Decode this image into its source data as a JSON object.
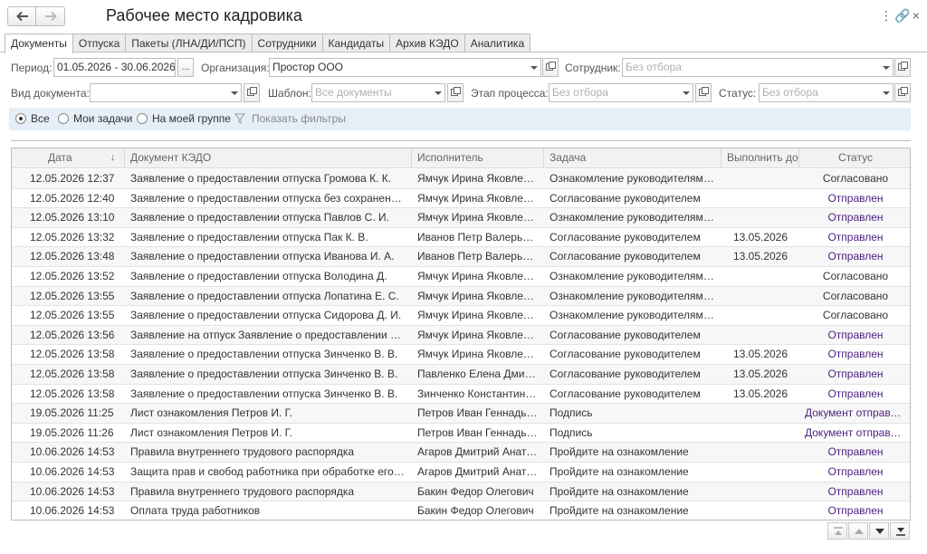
{
  "window": {
    "title": "Рабочее место кадровика"
  },
  "titlebar_icons": [
    "more-icon",
    "link-icon",
    "close-icon"
  ],
  "tabs": [
    {
      "label": "Документы",
      "active": true
    },
    {
      "label": "Отпуска"
    },
    {
      "label": "Пакеты (ЛНА/ДИ/ПСП)"
    },
    {
      "label": "Сотрудники"
    },
    {
      "label": "Кандидаты"
    },
    {
      "label": "Архив КЭДО"
    },
    {
      "label": "Аналитика"
    }
  ],
  "filters": {
    "period_label": "Период:",
    "period_value": "01.05.2026 - 30.06.2026",
    "period_btn": "...",
    "org_label": "Организация:",
    "org_value": "Простор ООО",
    "employee_label": "Сотрудник:",
    "employee_placeholder": "Без отбора",
    "doctype_label": "Вид документа:",
    "doctype_value": "",
    "template_label": "Шаблон:",
    "template_placeholder": "Все документы",
    "stage_label": "Этап процесса:",
    "stage_placeholder": "Без отбора",
    "status_label": "Статус:",
    "status_placeholder": "Без отбора"
  },
  "scope": {
    "all": "Все",
    "my_tasks": "Мои задачи",
    "my_group": "На моей группе",
    "show_filters": "Показать фильтры",
    "selected": "all"
  },
  "table": {
    "columns": {
      "date": "Дата",
      "doc": "Документ КЭДО",
      "executor": "Исполнитель",
      "task": "Задача",
      "due": "Выполнить до",
      "status": "Статус"
    },
    "sort_indicator": "↓",
    "rows": [
      {
        "date": "12.05.2026 12:37",
        "doc": "Заявление о предоставлении отпуска Громова К. К.",
        "executor": "Ямчук Ирина Яковлевна",
        "task": "Ознакомление руководителями ...",
        "due": "",
        "status": "Согласовано"
      },
      {
        "date": "12.05.2026 12:40",
        "doc": "Заявление о предоставлении отпуска без сохранения з...",
        "executor": "Ямчук Ирина Яковлевна",
        "task": "Согласование руководителем",
        "due": "",
        "status": "Отправлен"
      },
      {
        "date": "12.05.2026 13:10",
        "doc": "Заявление о предоставлении отпуска Павлов С. И.",
        "executor": "Ямчук Ирина Яковлевна",
        "task": "Ознакомление руководителями ...",
        "due": "",
        "status": "Отправлен"
      },
      {
        "date": "12.05.2026 13:32",
        "doc": "Заявление о предоставлении отпуска Пак К. В.",
        "executor": "Иванов Петр Валерьян...",
        "task": "Согласование руководителем",
        "due": "13.05.2026",
        "status": "Отправлен"
      },
      {
        "date": "12.05.2026 13:48",
        "doc": "Заявление о предоставлении отпуска Иванова И. А.",
        "executor": "Иванов Петр Валерьян...",
        "task": "Согласование руководителем",
        "due": "13.05.2026",
        "status": "Отправлен"
      },
      {
        "date": "12.05.2026 13:52",
        "doc": "Заявление о предоставлении отпуска Володина Д.",
        "executor": "Ямчук Ирина Яковлевна",
        "task": "Ознакомление руководителями ...",
        "due": "",
        "status": "Согласовано"
      },
      {
        "date": "12.05.2026 13:55",
        "doc": "Заявление о предоставлении отпуска Лопатина Е. С.",
        "executor": "Ямчук Ирина Яковлевна",
        "task": "Ознакомление руководителями ...",
        "due": "",
        "status": "Согласовано"
      },
      {
        "date": "12.05.2026 13:55",
        "doc": "Заявление о предоставлении отпуска Сидорова Д. И.",
        "executor": "Ямчук Ирина Яковлевна",
        "task": "Ознакомление руководителями ...",
        "due": "",
        "status": "Согласовано"
      },
      {
        "date": "12.05.2026 13:56",
        "doc": "Заявление на отпуск Заявление о предоставлении отпу...",
        "executor": "Ямчук Ирина Яковлевна",
        "task": "Согласование руководителем",
        "due": "",
        "status": "Отправлен"
      },
      {
        "date": "12.05.2026 13:58",
        "doc": "Заявление о предоставлении отпуска Зинченко В. В.",
        "executor": "Ямчук Ирина Яковлевна",
        "task": "Согласование руководителем",
        "due": "13.05.2026",
        "status": "Отправлен"
      },
      {
        "date": "12.05.2026 13:58",
        "doc": "Заявление о предоставлении отпуска Зинченко В. В.",
        "executor": "Павленко Елена Дмитр...",
        "task": "Согласование руководителем",
        "due": "13.05.2026",
        "status": "Отправлен"
      },
      {
        "date": "12.05.2026 13:58",
        "doc": "Заявление о предоставлении отпуска Зинченко В. В.",
        "executor": "Зинченко Константин П...",
        "task": "Согласование руководителем",
        "due": "13.05.2026",
        "status": "Отправлен"
      },
      {
        "date": "19.05.2026 11:25",
        "doc": "Лист ознакомления Петров И. Г.",
        "executor": "Петров Иван Геннадье...",
        "task": "Подпись",
        "due": "",
        "status": "Документ отправлен"
      },
      {
        "date": "19.05.2026 11:26",
        "doc": "Лист ознакомления Петров И. Г.",
        "executor": "Петров Иван Геннадье...",
        "task": "Подпись",
        "due": "",
        "status": "Документ отправлен"
      },
      {
        "date": "10.06.2026 14:53",
        "doc": "Правила внутреннего трудового распорядка",
        "executor": "Агаров Дмитрий Анатол...",
        "task": "Пройдите на ознакомление",
        "due": "",
        "status": "Отправлен"
      },
      {
        "date": "10.06.2026 14:53",
        "doc": "Защита прав и свобод работника при обработке его пе...",
        "executor": "Агаров Дмитрий Анатол...",
        "task": "Пройдите на ознакомление",
        "due": "",
        "status": "Отправлен"
      },
      {
        "date": "10.06.2026 14:53",
        "doc": "Правила внутреннего трудового распорядка",
        "executor": "Бакин Федор Олегович",
        "task": "Пройдите на ознакомление",
        "due": "",
        "status": "Отправлен"
      },
      {
        "date": "10.06.2026 14:53",
        "doc": "Оплата труда работников",
        "executor": "Бакин Федор Олегович",
        "task": "Пройдите на ознакомление",
        "due": "",
        "status": "Отправлен"
      }
    ]
  },
  "colors": {
    "status_sent": "#4b1f7f",
    "status_agreed": "#333333",
    "filter_bar_bg": "#e6eef7"
  }
}
